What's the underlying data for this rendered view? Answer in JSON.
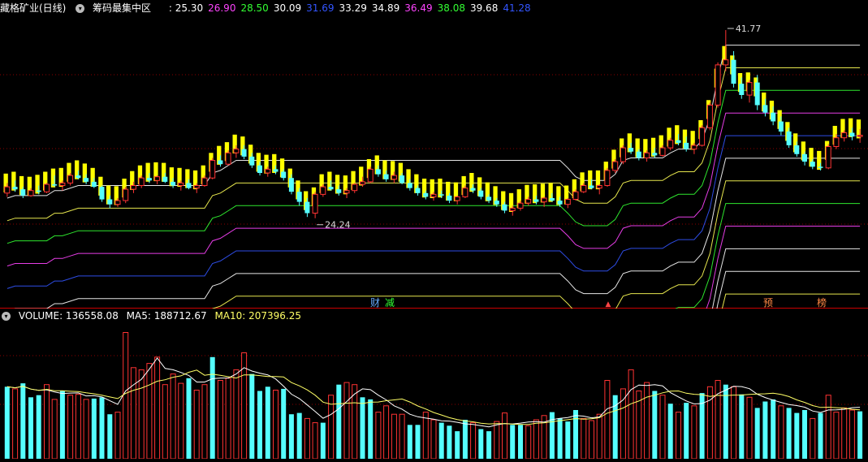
{
  "header": {
    "stock_name": "藏格矿业(日线)",
    "indicator_name": "筹码最集中区",
    "values": [
      {
        "text": ": 25.30",
        "color": "#ffffff"
      },
      {
        "text": "26.90",
        "color": "#ff44ff"
      },
      {
        "text": "28.50",
        "color": "#33ff33"
      },
      {
        "text": "30.09",
        "color": "#ffffff"
      },
      {
        "text": "31.69",
        "color": "#3355ff"
      },
      {
        "text": "33.29",
        "color": "#ffffff"
      },
      {
        "text": "34.89",
        "color": "#ffffff"
      },
      {
        "text": "36.49",
        "color": "#ff44ff"
      },
      {
        "text": "38.08",
        "color": "#33ff33"
      },
      {
        "text": "39.68",
        "color": "#ffffff"
      },
      {
        "text": "41.28",
        "color": "#3355ff"
      }
    ]
  },
  "markers": [
    {
      "text": "财",
      "color": "#66aaff"
    },
    {
      "text": "减",
      "color": "#33ff33"
    },
    {
      "text": "预",
      "color": "#ff8844"
    },
    {
      "text": "榜",
      "color": "#ff8844"
    }
  ],
  "volume_header": {
    "label": "VOLUME: 136558.08",
    "ma5": "MA5: 188712.67",
    "ma10": "MA10: 207396.25"
  },
  "colors": {
    "up": "#ff3333",
    "down": "#55ffff",
    "chip": "#ffff00",
    "ma5": "#ffffff",
    "ma10": "#ffff66",
    "grid": "#8b0000"
  },
  "chart_data": [
    {
      "type": "candlestick",
      "title": "藏格矿业(日线)",
      "ylim": [
        20,
        43
      ],
      "annotations": [
        {
          "text": "41.77",
          "kind": "high",
          "value": 41.77
        },
        {
          "text": "24.24",
          "kind": "low",
          "value": 24.24
        }
      ],
      "candles": [
        [
          28.8,
          29.6,
          28.5,
          29.3
        ],
        [
          29.3,
          29.8,
          28.9,
          29.1
        ],
        [
          29.1,
          29.3,
          28.4,
          28.6
        ],
        [
          28.6,
          29.2,
          28.5,
          29.0
        ],
        [
          29.0,
          29.4,
          28.7,
          28.9
        ],
        [
          28.9,
          29.6,
          28.8,
          29.5
        ],
        [
          29.5,
          30.2,
          29.3,
          29.4
        ],
        [
          29.4,
          29.8,
          29.0,
          29.6
        ],
        [
          29.6,
          30.4,
          29.4,
          30.2
        ],
        [
          30.2,
          30.6,
          29.9,
          30.0
        ],
        [
          30.0,
          30.3,
          29.5,
          29.7
        ],
        [
          29.7,
          30.0,
          29.2,
          29.3
        ],
        [
          29.3,
          29.4,
          28.1,
          28.3
        ],
        [
          28.3,
          28.6,
          27.6,
          27.9
        ],
        [
          27.9,
          28.4,
          27.7,
          28.2
        ],
        [
          28.2,
          29.3,
          28.0,
          29.1
        ],
        [
          29.1,
          29.7,
          28.8,
          29.4
        ],
        [
          29.4,
          30.2,
          29.2,
          30.0
        ],
        [
          30.0,
          30.4,
          29.6,
          29.8
        ],
        [
          29.8,
          30.2,
          29.5,
          30.1
        ],
        [
          30.1,
          30.4,
          29.6,
          29.7
        ],
        [
          29.7,
          30.0,
          29.2,
          29.4
        ],
        [
          29.4,
          29.8,
          29.0,
          29.6
        ],
        [
          29.6,
          29.9,
          29.1,
          29.2
        ],
        [
          29.2,
          29.6,
          28.8,
          29.4
        ],
        [
          29.4,
          30.2,
          29.3,
          30.0
        ],
        [
          30.0,
          31.6,
          29.9,
          31.4
        ],
        [
          31.4,
          31.8,
          30.9,
          31.1
        ],
        [
          31.1,
          32.2,
          31.0,
          32.0
        ],
        [
          32.0,
          32.6,
          31.6,
          32.3
        ],
        [
          32.3,
          32.6,
          31.5,
          31.7
        ],
        [
          31.7,
          32.0,
          30.8,
          31.0
        ],
        [
          31.0,
          31.3,
          30.2,
          30.4
        ],
        [
          30.4,
          30.9,
          30.1,
          30.7
        ],
        [
          30.7,
          31.0,
          30.3,
          30.5
        ],
        [
          30.5,
          30.7,
          29.8,
          30.0
        ],
        [
          30.0,
          30.3,
          28.7,
          28.9
        ],
        [
          28.9,
          29.2,
          27.8,
          28.1
        ],
        [
          28.1,
          28.4,
          26.9,
          27.2
        ],
        [
          27.2,
          28.9,
          26.8,
          28.7
        ],
        [
          28.7,
          29.5,
          28.5,
          29.3
        ],
        [
          29.3,
          29.8,
          29.0,
          29.1
        ],
        [
          29.1,
          29.4,
          28.6,
          28.8
        ],
        [
          28.8,
          29.2,
          28.4,
          29.0
        ],
        [
          29.0,
          29.6,
          28.8,
          29.5
        ],
        [
          29.5,
          30.1,
          29.3,
          29.7
        ],
        [
          29.7,
          30.9,
          29.6,
          30.7
        ],
        [
          30.7,
          31.0,
          30.1,
          30.3
        ],
        [
          30.3,
          30.6,
          29.7,
          29.9
        ],
        [
          29.9,
          30.5,
          29.6,
          30.2
        ],
        [
          30.2,
          30.4,
          29.5,
          29.6
        ],
        [
          29.6,
          29.9,
          29.0,
          29.2
        ],
        [
          29.2,
          29.4,
          28.6,
          28.8
        ],
        [
          28.8,
          29.0,
          28.3,
          28.5
        ],
        [
          28.5,
          28.9,
          28.2,
          28.7
        ],
        [
          28.7,
          29.0,
          28.4,
          28.6
        ],
        [
          28.6,
          28.8,
          28.0,
          28.2
        ],
        [
          28.2,
          28.6,
          27.9,
          28.5
        ],
        [
          28.5,
          29.4,
          28.4,
          29.2
        ],
        [
          29.2,
          29.5,
          28.8,
          29.0
        ],
        [
          29.0,
          29.2,
          28.3,
          28.5
        ],
        [
          28.5,
          28.7,
          28.0,
          28.2
        ],
        [
          28.2,
          28.4,
          27.7,
          27.9
        ],
        [
          27.9,
          28.1,
          27.2,
          27.4
        ],
        [
          27.4,
          27.8,
          27.0,
          27.6
        ],
        [
          27.6,
          28.2,
          27.4,
          28.0
        ],
        [
          28.0,
          28.5,
          27.8,
          28.3
        ],
        [
          28.3,
          28.6,
          27.9,
          28.1
        ],
        [
          28.1,
          28.5,
          27.7,
          28.4
        ],
        [
          28.4,
          28.8,
          28.1,
          28.2
        ],
        [
          28.2,
          28.5,
          27.7,
          27.9
        ],
        [
          27.9,
          28.4,
          27.6,
          28.3
        ],
        [
          28.3,
          29.1,
          28.2,
          28.9
        ],
        [
          28.9,
          29.6,
          28.8,
          29.4
        ],
        [
          29.4,
          29.9,
          29.1,
          29.2
        ],
        [
          29.2,
          29.5,
          28.7,
          29.4
        ],
        [
          29.4,
          30.8,
          29.3,
          30.6
        ],
        [
          30.6,
          31.5,
          30.4,
          31.3
        ],
        [
          31.3,
          32.6,
          31.1,
          32.4
        ],
        [
          32.4,
          32.8,
          31.9,
          32.1
        ],
        [
          32.1,
          32.3,
          31.4,
          31.6
        ],
        [
          31.6,
          32.2,
          31.3,
          32.0
        ],
        [
          32.0,
          32.4,
          31.6,
          31.8
        ],
        [
          31.8,
          32.6,
          31.7,
          32.4
        ],
        [
          32.4,
          33.2,
          32.2,
          33.0
        ],
        [
          33.0,
          33.5,
          32.6,
          32.8
        ],
        [
          32.8,
          33.3,
          32.1,
          32.3
        ],
        [
          32.3,
          32.8,
          31.9,
          32.6
        ],
        [
          32.6,
          34.2,
          32.5,
          34.0
        ],
        [
          34.0,
          36.0,
          33.8,
          35.8
        ],
        [
          35.8,
          39.2,
          35.6,
          39.0
        ],
        [
          39.0,
          41.77,
          38.5,
          39.4
        ],
        [
          39.4,
          40.1,
          37.2,
          37.5
        ],
        [
          37.5,
          38.0,
          36.3,
          36.6
        ],
        [
          36.6,
          37.8,
          36.0,
          37.6
        ],
        [
          37.6,
          38.2,
          35.4,
          35.8
        ],
        [
          35.8,
          36.3,
          34.9,
          35.2
        ],
        [
          35.2,
          35.7,
          34.2,
          34.5
        ],
        [
          34.5,
          34.9,
          33.4,
          33.7
        ],
        [
          33.7,
          34.0,
          32.4,
          32.6
        ],
        [
          32.6,
          32.9,
          31.7,
          31.9
        ],
        [
          31.9,
          32.1,
          31.0,
          31.3
        ],
        [
          31.3,
          31.5,
          30.7,
          30.9
        ],
        [
          30.9,
          31.2,
          30.6,
          30.8
        ],
        [
          30.8,
          32.7,
          30.7,
          32.5
        ],
        [
          32.5,
          33.5,
          32.3,
          33.2
        ],
        [
          33.2,
          33.8,
          32.9,
          33.6
        ],
        [
          33.6,
          34.0,
          33.0,
          33.3
        ],
        [
          33.3,
          33.9,
          32.8,
          33.4
        ]
      ],
      "volume": [
        [
          "d",
          170
        ],
        [
          "u",
          165
        ],
        [
          "d",
          178
        ],
        [
          "d",
          145
        ],
        [
          "d",
          150
        ],
        [
          "u",
          175
        ],
        [
          "u",
          140
        ],
        [
          "d",
          160
        ],
        [
          "u",
          150
        ],
        [
          "u",
          152
        ],
        [
          "u",
          140
        ],
        [
          "d",
          142
        ],
        [
          "d",
          145
        ],
        [
          "d",
          105
        ],
        [
          "u",
          110
        ],
        [
          "u",
          298
        ],
        [
          "u",
          215
        ],
        [
          "u",
          210
        ],
        [
          "u",
          225
        ],
        [
          "u",
          240
        ],
        [
          "u",
          175
        ],
        [
          "u",
          200
        ],
        [
          "u",
          178
        ],
        [
          "d",
          190
        ],
        [
          "u",
          162
        ],
        [
          "u",
          175
        ],
        [
          "d",
          240
        ],
        [
          "u",
          185
        ],
        [
          "u",
          190
        ],
        [
          "u",
          210
        ],
        [
          "u",
          250
        ],
        [
          "d",
          200
        ],
        [
          "d",
          160
        ],
        [
          "d",
          170
        ],
        [
          "u",
          162
        ],
        [
          "d",
          165
        ],
        [
          "d",
          105
        ],
        [
          "d",
          108
        ],
        [
          "u",
          95
        ],
        [
          "u",
          85
        ],
        [
          "d",
          85
        ],
        [
          "u",
          150
        ],
        [
          "d",
          175
        ],
        [
          "u",
          180
        ],
        [
          "u",
          175
        ],
        [
          "d",
          145
        ],
        [
          "d",
          140
        ],
        [
          "u",
          110
        ],
        [
          "u",
          125
        ],
        [
          "u",
          105
        ],
        [
          "u",
          105
        ],
        [
          "d",
          80
        ],
        [
          "d",
          80
        ],
        [
          "u",
          110
        ],
        [
          "u",
          92
        ],
        [
          "d",
          85
        ],
        [
          "d",
          78
        ],
        [
          "d",
          65
        ],
        [
          "d",
          92
        ],
        [
          "u",
          85
        ],
        [
          "d",
          70
        ],
        [
          "d",
          65
        ],
        [
          "u",
          88
        ],
        [
          "u",
          108
        ],
        [
          "d",
          80
        ],
        [
          "d",
          80
        ],
        [
          "u",
          78
        ],
        [
          "u",
          92
        ],
        [
          "u",
          102
        ],
        [
          "d",
          110
        ],
        [
          "d",
          95
        ],
        [
          "d",
          88
        ],
        [
          "d",
          115
        ],
        [
          "u",
          95
        ],
        [
          "u",
          90
        ],
        [
          "u",
          105
        ],
        [
          "u",
          185
        ],
        [
          "d",
          150
        ],
        [
          "u",
          165
        ],
        [
          "u",
          210
        ],
        [
          "u",
          160
        ],
        [
          "u",
          180
        ],
        [
          "d",
          160
        ],
        [
          "u",
          150
        ],
        [
          "d",
          130
        ],
        [
          "u",
          110
        ],
        [
          "d",
          132
        ],
        [
          "u",
          125
        ],
        [
          "d",
          155
        ],
        [
          "u",
          170
        ],
        [
          "u",
          185
        ],
        [
          "d",
          175
        ],
        [
          "u",
          170
        ],
        [
          "d",
          152
        ],
        [
          "u",
          145
        ],
        [
          "d",
          120
        ],
        [
          "d",
          135
        ],
        [
          "d",
          140
        ],
        [
          "u",
          125
        ],
        [
          "d",
          120
        ],
        [
          "d",
          108
        ],
        [
          "d",
          115
        ],
        [
          "u",
          95
        ],
        [
          "d",
          108
        ],
        [
          "u",
          150
        ],
        [
          "u",
          110
        ],
        [
          "u",
          120
        ],
        [
          "u",
          115
        ],
        [
          "d",
          112
        ]
      ]
    },
    {
      "type": "bar",
      "title": "VOLUME",
      "series": [
        {
          "name": "VOLUME",
          "last": 136558.08
        },
        {
          "name": "MA5",
          "last": 188712.67
        },
        {
          "name": "MA10",
          "last": 207396.25
        }
      ]
    }
  ]
}
